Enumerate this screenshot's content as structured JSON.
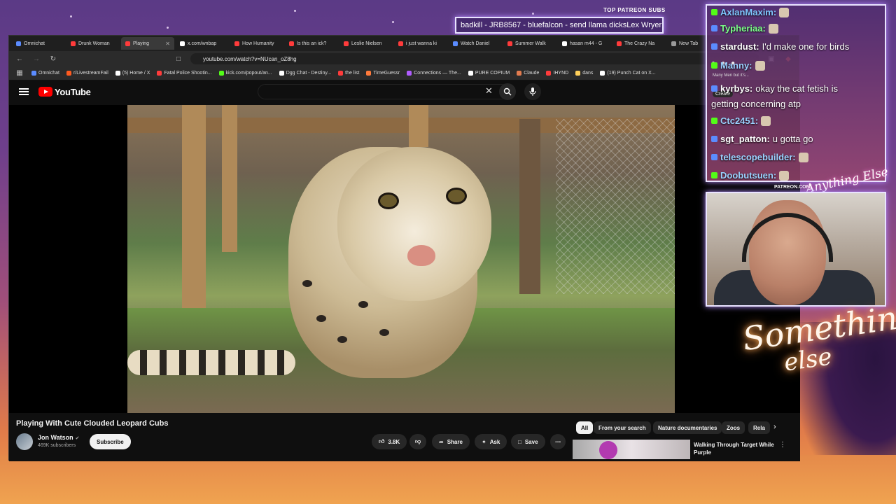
{
  "overlay": {
    "patreon_header": "TOP PATREON SUBS",
    "ticker_text": "badkill - JRB8567 - bluefalcon - send llama dicksLex Wryer",
    "patreon_url": "PATREON.COM/",
    "signature": "Anything Else",
    "logo_line1": "Something",
    "logo_line2": "else"
  },
  "chat": {
    "messages": [
      {
        "user": "AxlanMaxim:",
        "text": "",
        "color": "#7fc7ff"
      },
      {
        "user": "Typheriaa:",
        "text": "",
        "color": "#7cff8a"
      },
      {
        "user": "stardust:",
        "text": " I'd make one for birds",
        "color": "#ffffff"
      },
      {
        "user": "Manny:",
        "text": "",
        "color": "#9bd2ff"
      },
      {
        "user": "kyrbys:",
        "text": " okay the cat fetish is",
        "color": "#ffffff"
      },
      {
        "user": "",
        "text": "getting concerning atp",
        "color": "#ffffff"
      },
      {
        "user": "Ctc2451:",
        "text": "",
        "color": "#9bd2ff"
      },
      {
        "user": "sgt_patton:",
        "text": " u gotta go",
        "color": "#ffffff"
      },
      {
        "user": "telescopebuilder:",
        "text": "",
        "color": "#9bd2ff"
      },
      {
        "user": "Doobutsuen:",
        "text": "",
        "color": "#9bd2ff"
      }
    ],
    "mini_text": "Many Men but it's...",
    "create_label": "Create"
  },
  "browser": {
    "tabs": [
      {
        "label": "Omnichat",
        "color": "#5b8cff",
        "active": false
      },
      {
        "label": "Drunk Woman",
        "color": "#ff3b3b",
        "active": false
      },
      {
        "label": "Playing",
        "color": "#ff3b3b",
        "active": true
      },
      {
        "label": "x.com/wnbap",
        "color": "#ffffff",
        "active": false
      },
      {
        "label": "How Humanity",
        "color": "#ff3b3b",
        "active": false
      },
      {
        "label": "Is this an ick?",
        "color": "#ff3b3b",
        "active": false
      },
      {
        "label": "Leslie Nielsen",
        "color": "#ff3b3b",
        "active": false
      },
      {
        "label": "i just wanna ki",
        "color": "#ff3b3b",
        "active": false
      },
      {
        "label": "Watch Daniel",
        "color": "#5b8cff",
        "active": false
      },
      {
        "label": "Summer Walk",
        "color": "#ff3b3b",
        "active": false
      },
      {
        "label": "hasan m44 - G",
        "color": "#ffffff",
        "active": false
      },
      {
        "label": "The Crazy Na",
        "color": "#ff3b3b",
        "active": false
      },
      {
        "label": "New Tab",
        "color": "#9a9a9a",
        "active": false
      }
    ],
    "url": "youtube.com/watch?v=NUcan_oZ8hg",
    "bookmarks": [
      {
        "label": "Omnichat",
        "color": "#5b8cff"
      },
      {
        "label": "r/LivestreamFail",
        "color": "#ff5a1f"
      },
      {
        "label": "(5) Home / X",
        "color": "#ffffff"
      },
      {
        "label": "Fatal Police Shootin...",
        "color": "#ff3b3b"
      },
      {
        "label": "kick.com/popout/an...",
        "color": "#53fc18"
      },
      {
        "label": "Dgg Chat - Destiny...",
        "color": "#ffffff"
      },
      {
        "label": "the list",
        "color": "#ff3b3b"
      },
      {
        "label": "TimeGuessr",
        "color": "#ff7a3b"
      },
      {
        "label": "Connections — The...",
        "color": "#b05cff"
      },
      {
        "label": "PURE COPIUM",
        "color": "#ffffff"
      },
      {
        "label": "Claude",
        "color": "#e27b4f"
      },
      {
        "label": "IHYND",
        "color": "#ff3b3b"
      },
      {
        "label": "dans",
        "color": "#ffd05a"
      },
      {
        "label": "(19) Punch Cat on X...",
        "color": "#ffffff"
      }
    ]
  },
  "youtube": {
    "logo_text": "YouTube",
    "video_title": "Playing With Cute Clouded Leopard Cubs",
    "channel_name": "Jon Watson",
    "subscriber_count": "469K subscribers",
    "subscribe_label": "Subscribe",
    "like_count": "3.8K",
    "share_label": "Share",
    "ask_label": "Ask",
    "save_label": "Save",
    "chips": [
      "All",
      "From your search",
      "Nature documentaries",
      "Zoos",
      "Rela"
    ],
    "recommended_title": "Walking Through Target While Purple"
  }
}
